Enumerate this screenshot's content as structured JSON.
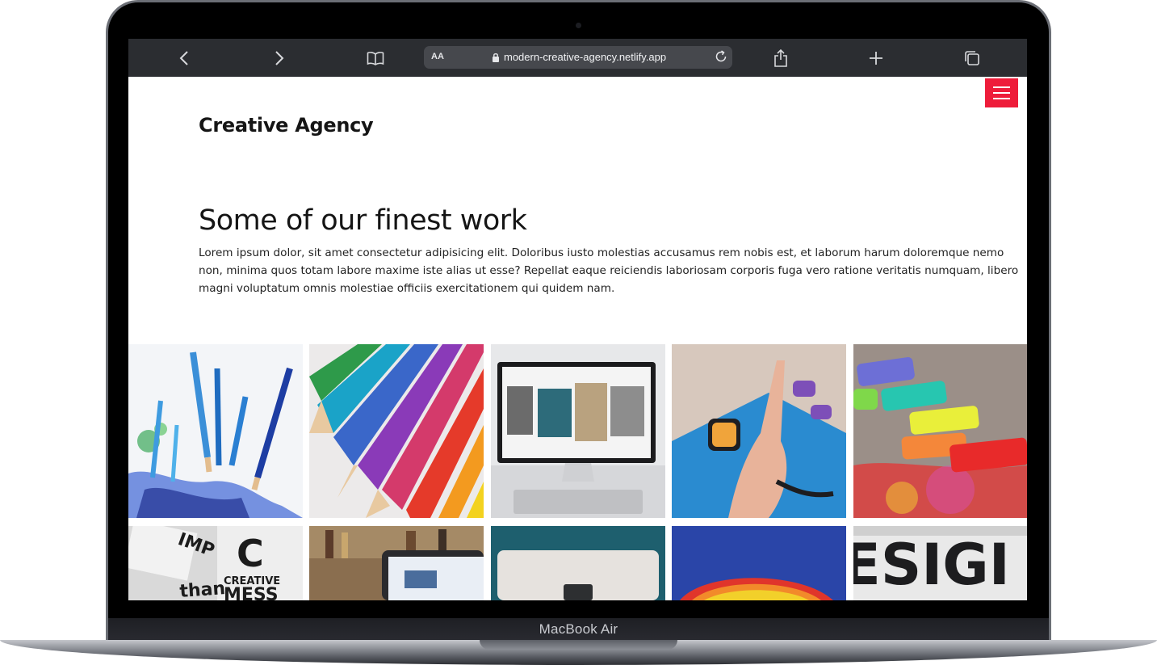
{
  "browser": {
    "address_bar": {
      "text_size_label": "AA",
      "url": "modern-creative-agency.netlify.app"
    }
  },
  "page": {
    "brand": "Creative Agency",
    "heading": "Some of our finest work",
    "lead": "Lorem ipsum dolor, sit amet consectetur adipisicing elit. Doloribus iusto molestias accusamus rem nobis est, et laborum harum doloremque nemo non, minima quos totam labore maxime iste alias ut esse? Repellat eaque reiciendis laboriosam corporis fuga vero ratione veritatis numquam, libero magni voluptatum omnis molestiae officiis exercitationem qui quidem nam."
  },
  "gallery": {
    "row1": [
      {
        "name": "blue-pencils-shavings"
      },
      {
        "name": "colored-pencils"
      },
      {
        "name": "desktop-monitor-gallery"
      },
      {
        "name": "smartwatch-yoga"
      },
      {
        "name": "chalk-pastels"
      }
    ],
    "row2": [
      {
        "name": "creative-mess-poster",
        "text": [
          "C",
          "CREATIVE",
          "MESS",
          "than",
          "IMP"
        ]
      },
      {
        "name": "laptop-bookshelf"
      },
      {
        "name": "laptop-teal-desk"
      },
      {
        "name": "rainbow-clay"
      },
      {
        "name": "design-letters",
        "text": "ESIGI"
      }
    ]
  },
  "device": {
    "label": "MacBook Air"
  },
  "colors": {
    "accent": "#ee1c3a",
    "toolbar": "#2b2d31"
  }
}
